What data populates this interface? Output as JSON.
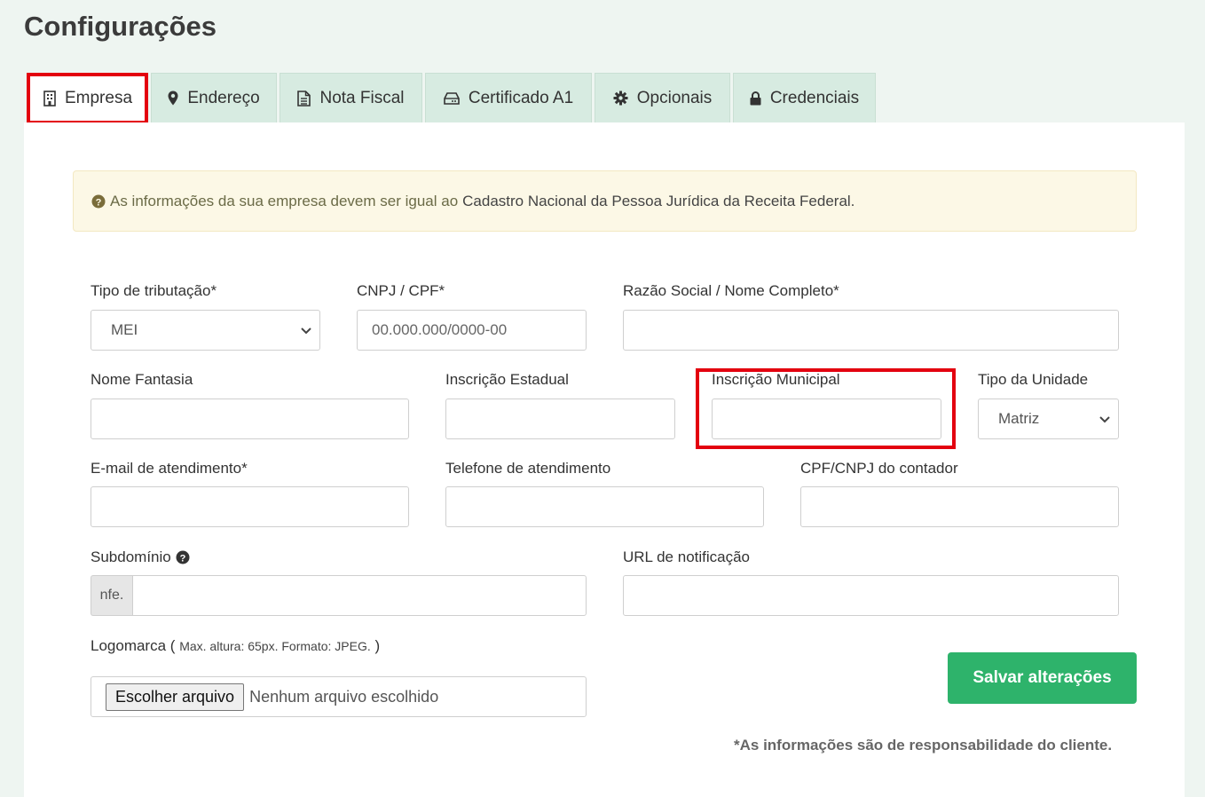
{
  "page": {
    "title": "Configurações"
  },
  "tabs": [
    {
      "label": "Empresa",
      "icon": "building-icon",
      "active": true
    },
    {
      "label": "Endereço",
      "icon": "map-marker-icon",
      "active": false
    },
    {
      "label": "Nota Fiscal",
      "icon": "file-text-icon",
      "active": false
    },
    {
      "label": "Certificado A1",
      "icon": "hdd-icon",
      "active": false
    },
    {
      "label": "Opcionais",
      "icon": "gear-icon",
      "active": false
    },
    {
      "label": "Credenciais",
      "icon": "lock-icon",
      "active": false
    }
  ],
  "alert": {
    "icon": "question-circle-icon",
    "text": "As informações da sua empresa devem ser igual ao",
    "strong": "Cadastro Nacional da Pessoa Jurídica da Receita Federal."
  },
  "form": {
    "tipo_tributacao": {
      "label": "Tipo de tributação*",
      "value": "MEI"
    },
    "cnpj_cpf": {
      "label": "CNPJ / CPF*",
      "placeholder": "00.000.000/0000-00"
    },
    "razao_social": {
      "label": "Razão Social / Nome Completo*",
      "value": ""
    },
    "nome_fantasia": {
      "label": "Nome Fantasia",
      "value": ""
    },
    "inscricao_estadual": {
      "label": "Inscrição Estadual",
      "value": ""
    },
    "inscricao_municipal": {
      "label": "Inscrição Municipal",
      "value": ""
    },
    "tipo_unidade": {
      "label": "Tipo da Unidade",
      "value": "Matriz"
    },
    "email_atendimento": {
      "label": "E-mail de atendimento*",
      "value": ""
    },
    "telefone_atendimento": {
      "label": "Telefone de atendimento",
      "value": ""
    },
    "cpf_cnpj_contador": {
      "label": "CPF/CNPJ do contador",
      "value": ""
    },
    "subdominio": {
      "label": "Subdomínio",
      "prefix": "nfe.",
      "value": ""
    },
    "url_notificacao": {
      "label": "URL de notificação",
      "value": ""
    },
    "logomarca": {
      "label": "Logomarca",
      "note_open": "(",
      "note": "Max. altura: 65px. Formato: JPEG.",
      "note_close": ")",
      "button": "Escolher arquivo",
      "status": "Nenhum arquivo escolhido"
    }
  },
  "actions": {
    "save": "Salvar alterações"
  },
  "footnote": "*As informações são de responsabilidade do cliente.",
  "colors": {
    "accent": "#2eb36b",
    "highlight": "#e3000f",
    "tab_bg": "#d7ebe1",
    "alert_bg": "#fcf8e6"
  }
}
